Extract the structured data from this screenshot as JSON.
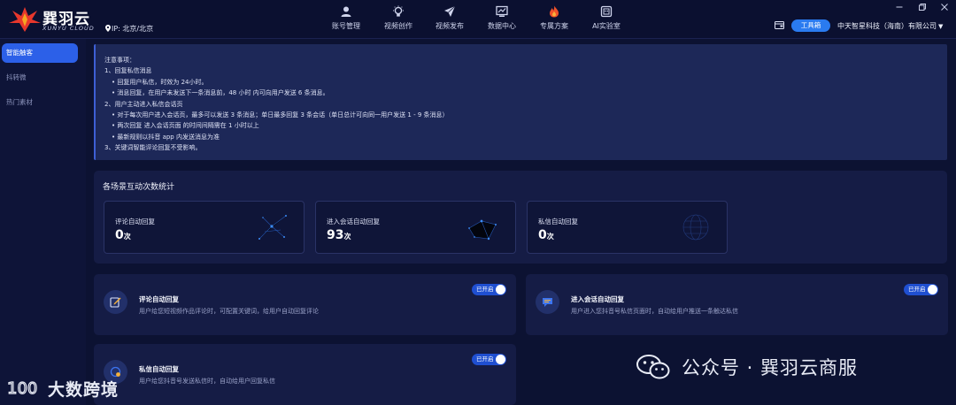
{
  "brand": {
    "name_cn": "巽羽云",
    "name_en": "XUNYU CLOUD"
  },
  "ip": {
    "label": "IP: 北京/北京"
  },
  "nav": [
    {
      "label": "账号管理",
      "icon": "user-icon"
    },
    {
      "label": "视频创作",
      "icon": "bulb-icon"
    },
    {
      "label": "视频发布",
      "icon": "send-icon"
    },
    {
      "label": "数据中心",
      "icon": "chart-icon"
    },
    {
      "label": "专属方案",
      "icon": "flame-icon"
    },
    {
      "label": "AI实验室",
      "icon": "robot-icon"
    }
  ],
  "header": {
    "tool_button": "工具箱",
    "company": "中天智星科技（海南）有限公司",
    "company_caret": "▼"
  },
  "sidebar": [
    {
      "label": "智能触客",
      "active": true
    },
    {
      "label": "抖转微",
      "active": false
    },
    {
      "label": "热门素材",
      "active": false
    }
  ],
  "notice": {
    "lines": [
      {
        "text": "注意事项：",
        "indent": 0
      },
      {
        "text": "1、回复私信消息",
        "indent": 0
      },
      {
        "text": "• 回复用户私信，时效为 24小时。",
        "indent": 1
      },
      {
        "text": "• 消息回复，在用户未发送下一条消息前，48 小时 内可向用户发送 6 条消息。",
        "indent": 1
      },
      {
        "text": "2、用户主动进入私信会话页",
        "indent": 0
      },
      {
        "text": "• 对于每次用户进入会话页，最多可以发送 3 条消息；单日最多回复 3 条会话（单日总计可向同一用户发送 1 - 9 条消息）",
        "indent": 1
      },
      {
        "text": "• 两次回复 进入会话页面 的时间间隔需在 1 小时以上",
        "indent": 1
      },
      {
        "text": "• 最新规则以抖音 app 内发送消息为准",
        "indent": 1
      },
      {
        "text": "3、关键词智能评论回复不受影响。",
        "indent": 0
      }
    ]
  },
  "stats": {
    "title": "各场景互动次数统计",
    "cards": [
      {
        "label": "评论自动回复",
        "value": "0",
        "unit": "次"
      },
      {
        "label": "进入会话自动回复",
        "value": "93",
        "unit": "次"
      },
      {
        "label": "私信自动回复",
        "value": "0",
        "unit": "次"
      }
    ]
  },
  "features": [
    {
      "title": "评论自动回复",
      "desc": "用户给您短视频作品评论时，可配置关键词，给用户自动回复评论",
      "toggle": "已开启",
      "icon": "edit-icon"
    },
    {
      "title": "进入会话自动回复",
      "desc": "用户进入您抖音号私信页面时，自动给用户推送一条触达私信",
      "toggle": "已开启",
      "icon": "chat-icon"
    },
    {
      "title": "私信自动回复",
      "desc": "用户给您抖音号发送私信时，自动给用户回复私信",
      "toggle": "已开启",
      "icon": "message-icon"
    }
  ],
  "watermarks": {
    "left": "大数跨境",
    "left_mark": "100",
    "right": "公众号 · 巽羽云商服"
  },
  "colors": {
    "accent": "#2c60e8",
    "toggle": "#1f4fd1",
    "background": "#0c1232",
    "card": "#151c45"
  }
}
